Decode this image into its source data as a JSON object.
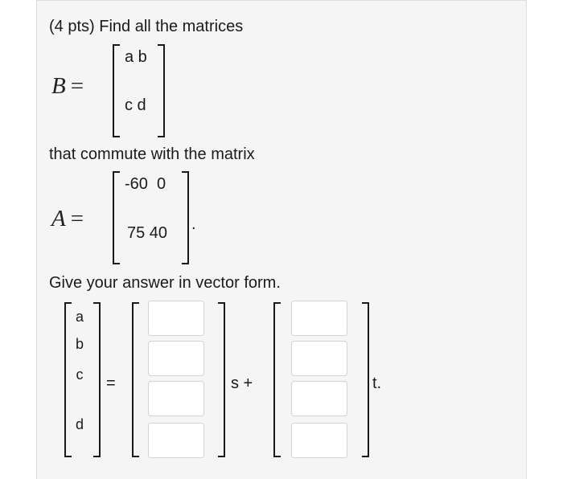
{
  "problem": {
    "heading": "(4 pts) Find all the matrices",
    "matrix_b": {
      "name": "B",
      "equals": "=",
      "row1": "a b",
      "row2": "c d"
    },
    "commute_text": "that commute with the matrix",
    "matrix_a": {
      "name": "A",
      "equals": "=",
      "row1": "-60  0",
      "row2": "75 40",
      "end_punct": "."
    },
    "answer_prompt": "Give your answer in vector form.",
    "vector": {
      "labels": [
        "a",
        "b",
        "c",
        "d"
      ],
      "equals": "=",
      "s_label": "s +",
      "t_label": "t.",
      "s_inputs": [
        "",
        "",
        "",
        ""
      ],
      "t_inputs": [
        "",
        "",
        "",
        ""
      ]
    }
  }
}
